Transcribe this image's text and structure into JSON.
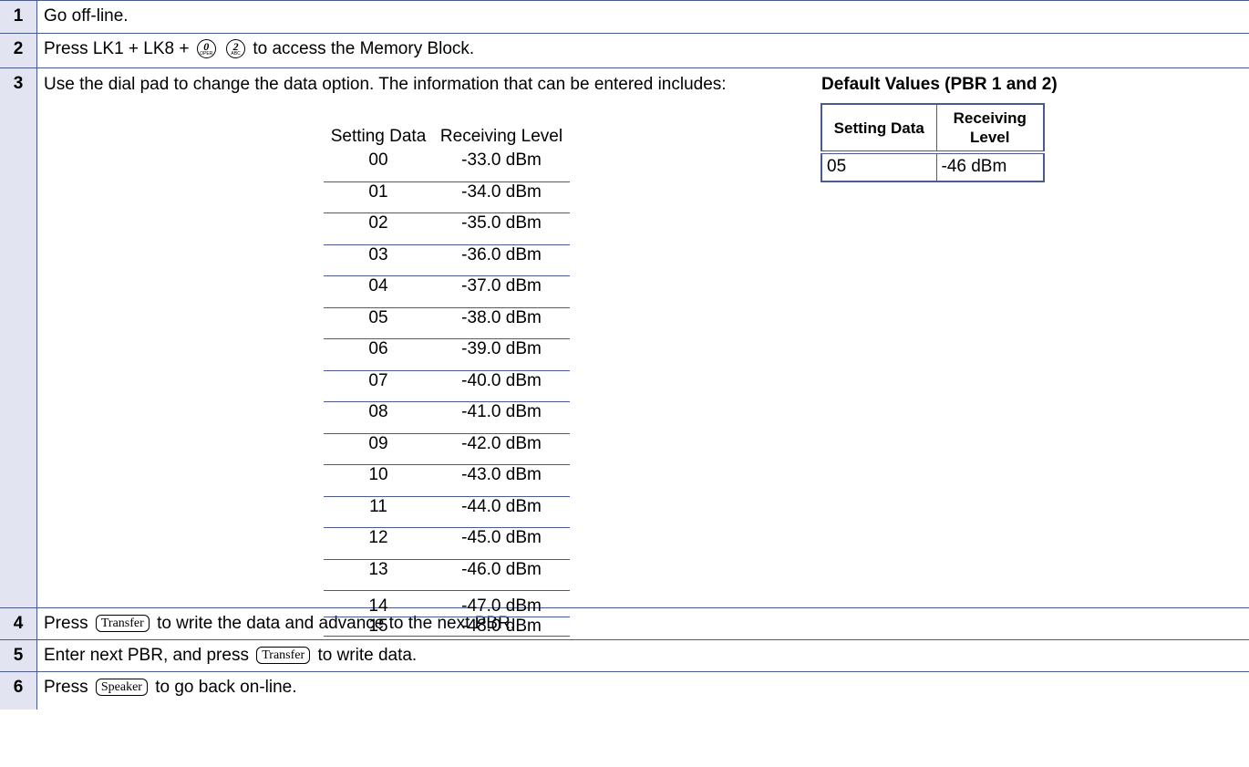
{
  "steps": [
    {
      "num": "1",
      "text": "Go off-line."
    },
    {
      "num": "2",
      "text_before": "Press LK1 + LK8 +",
      "keys": [
        {
          "digit": "0",
          "sub": "OPER"
        },
        {
          "digit": "2",
          "sub": "ABC"
        }
      ],
      "text_after": "to access the Memory Block."
    },
    {
      "num": "3",
      "text": "Use the dial pad to change the  data option.  The information that can be entered includes:"
    },
    {
      "num": "4",
      "text_before": "Press",
      "key": "Transfer",
      "text_after": "to write the data and advance to the next PBR."
    },
    {
      "num": "5",
      "text_before": "Enter next PBR, and press",
      "key": "Transfer",
      "text_after": "to write data."
    },
    {
      "num": "6",
      "text_before": "Press",
      "key": "Speaker",
      "text_after": "to go back on-line."
    }
  ],
  "levels": {
    "headers": [
      "Setting Data",
      "Receiving Level"
    ],
    "rows": [
      [
        "00",
        "-33.0 dBm"
      ],
      [
        "01",
        "-34.0 dBm"
      ],
      [
        "02",
        "-35.0 dBm"
      ],
      [
        "03",
        "-36.0 dBm"
      ],
      [
        "04",
        "-37.0 dBm"
      ],
      [
        "05",
        "-38.0 dBm"
      ],
      [
        "06",
        "-39.0 dBm"
      ],
      [
        "07",
        "-40.0 dBm"
      ],
      [
        "08",
        "-41.0 dBm"
      ],
      [
        "09",
        "-42.0 dBm"
      ],
      [
        "10",
        "-43.0 dBm"
      ],
      [
        "11",
        "-44.0 dBm"
      ],
      [
        "12",
        "-45.0 dBm"
      ],
      [
        "13",
        "-46.0 dBm"
      ],
      [
        "14",
        "-47.0 dBm"
      ],
      [
        "15",
        "-48.0 dBm"
      ]
    ]
  },
  "defaults": {
    "caption": "Default Values (PBR 1 and 2)",
    "headers": [
      "Setting Data",
      "Receiving Level"
    ],
    "row": [
      "05",
      "-46 dBm"
    ]
  },
  "icons": [
    "dial-key-0-icon",
    "dial-key-2-icon",
    "transfer-key-icon",
    "speaker-key-icon"
  ],
  "colors": {
    "border": "#4a5a8c",
    "number_cell": "#e2e4f1"
  }
}
